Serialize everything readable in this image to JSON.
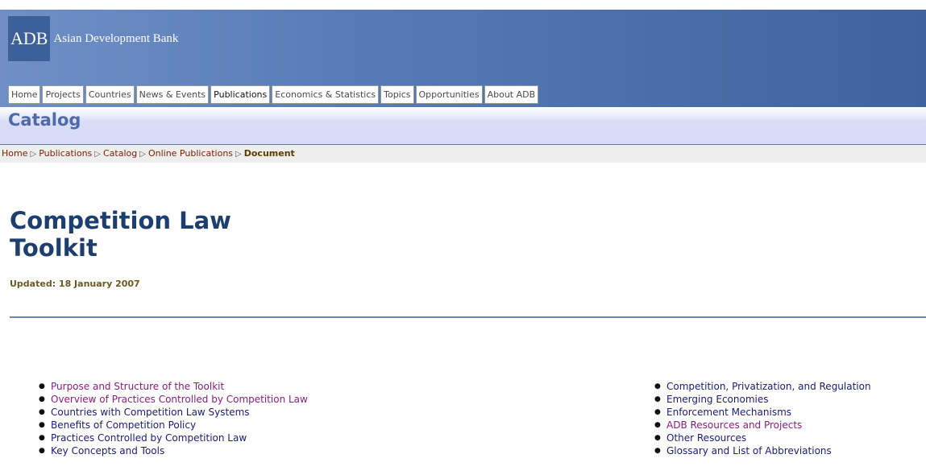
{
  "header": {
    "logo_abbr": "ADB",
    "logo_name": "Asian Development Bank",
    "tabs": [
      "Home",
      "Projects",
      "Countries",
      "News & Events",
      "Publications",
      "Economics & Statistics",
      "Topics",
      "Opportunities",
      "About ADB"
    ],
    "active_tab": "Publications"
  },
  "section_title": "Catalog",
  "breadcrumb": {
    "items": [
      "Home",
      "Publications",
      "Catalog",
      "Online Publications"
    ],
    "current": "Document"
  },
  "document": {
    "title_line1": "Competition Law",
    "title_line2": "Toolkit",
    "updated": "Updated: 18 January 2007"
  },
  "toc": {
    "left": [
      {
        "label": "Purpose and Structure of the Toolkit",
        "visited": true
      },
      {
        "label": "Overview of Practices Controlled by Competition Law",
        "visited": true
      },
      {
        "label": "Countries with Competition Law Systems",
        "visited": false
      },
      {
        "label": "Benefits of Competition Policy",
        "visited": false
      },
      {
        "label": "Practices Controlled by Competition Law",
        "visited": false
      },
      {
        "label": "Key Concepts and Tools",
        "visited": false
      }
    ],
    "right": [
      {
        "label": "Competition, Privatization, and Regulation",
        "visited": false
      },
      {
        "label": "Emerging Economies",
        "visited": false
      },
      {
        "label": "Enforcement Mechanisms",
        "visited": false
      },
      {
        "label": "ADB Resources and Projects",
        "visited": true
      },
      {
        "label": "Other Resources",
        "visited": false
      },
      {
        "label": "Glossary and List of Abbreviations",
        "visited": false
      }
    ]
  },
  "colors": {
    "header_blue": "#4f6fa8",
    "title_blue": "#1c3f6e",
    "visited_link": "#8e1b7d",
    "link": "#1a1a7a"
  }
}
